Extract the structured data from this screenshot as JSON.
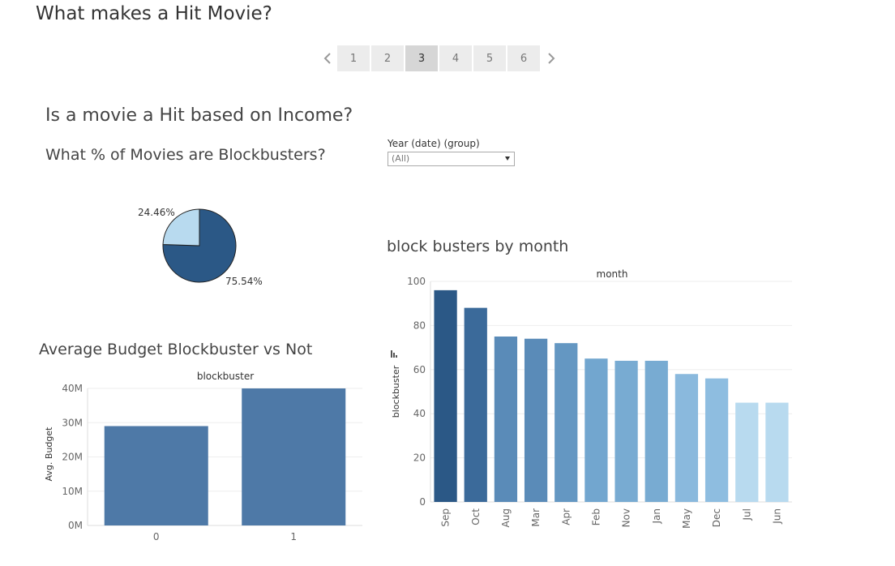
{
  "story": {
    "title": "What makes a Hit Movie?",
    "pages": [
      "1",
      "2",
      "3",
      "4",
      "5",
      "6"
    ],
    "active_page": "3"
  },
  "dashboard": {
    "title": "Is a movie a Hit based on Income?"
  },
  "filter": {
    "label": "Year (date) (group)",
    "value": "(All)"
  },
  "chart_data": [
    {
      "type": "pie",
      "title": "What % of Movies are Blockbusters?",
      "slices": [
        {
          "label": "75.54%",
          "value": 75.54,
          "color": "#2b5886"
        },
        {
          "label": "24.46%",
          "value": 24.46,
          "color": "#b8daef"
        }
      ]
    },
    {
      "type": "bar",
      "title": "Average Budget Blockbuster vs Not",
      "header": "blockbuster",
      "categories": [
        "0",
        "1"
      ],
      "values": [
        29,
        40
      ],
      "ylabel": "Avg. Budget",
      "yticks": [
        "0M",
        "10M",
        "20M",
        "30M",
        "40M"
      ],
      "ylim": [
        0,
        40
      ],
      "color": "#4e79a7"
    },
    {
      "type": "bar",
      "title": "block busters by month",
      "header": "month",
      "categories": [
        "Sep",
        "Oct",
        "Aug",
        "Mar",
        "Apr",
        "Feb",
        "Nov",
        "Jan",
        "May",
        "Dec",
        "Jul",
        "Jun"
      ],
      "values": [
        96,
        88,
        75,
        74,
        72,
        65,
        64,
        64,
        58,
        56,
        45,
        45
      ],
      "colors": [
        "#2b5886",
        "#3b6a9a",
        "#5a8bb8",
        "#5a8bb8",
        "#6497c2",
        "#72a6cf",
        "#78abd2",
        "#78abd2",
        "#8ab9dd",
        "#8ebde0",
        "#b8daef",
        "#b8daef"
      ],
      "ylabel": "blockbuster",
      "yticks": [
        "0",
        "20",
        "40",
        "60",
        "80",
        "100"
      ],
      "ylim": [
        0,
        100
      ]
    }
  ]
}
